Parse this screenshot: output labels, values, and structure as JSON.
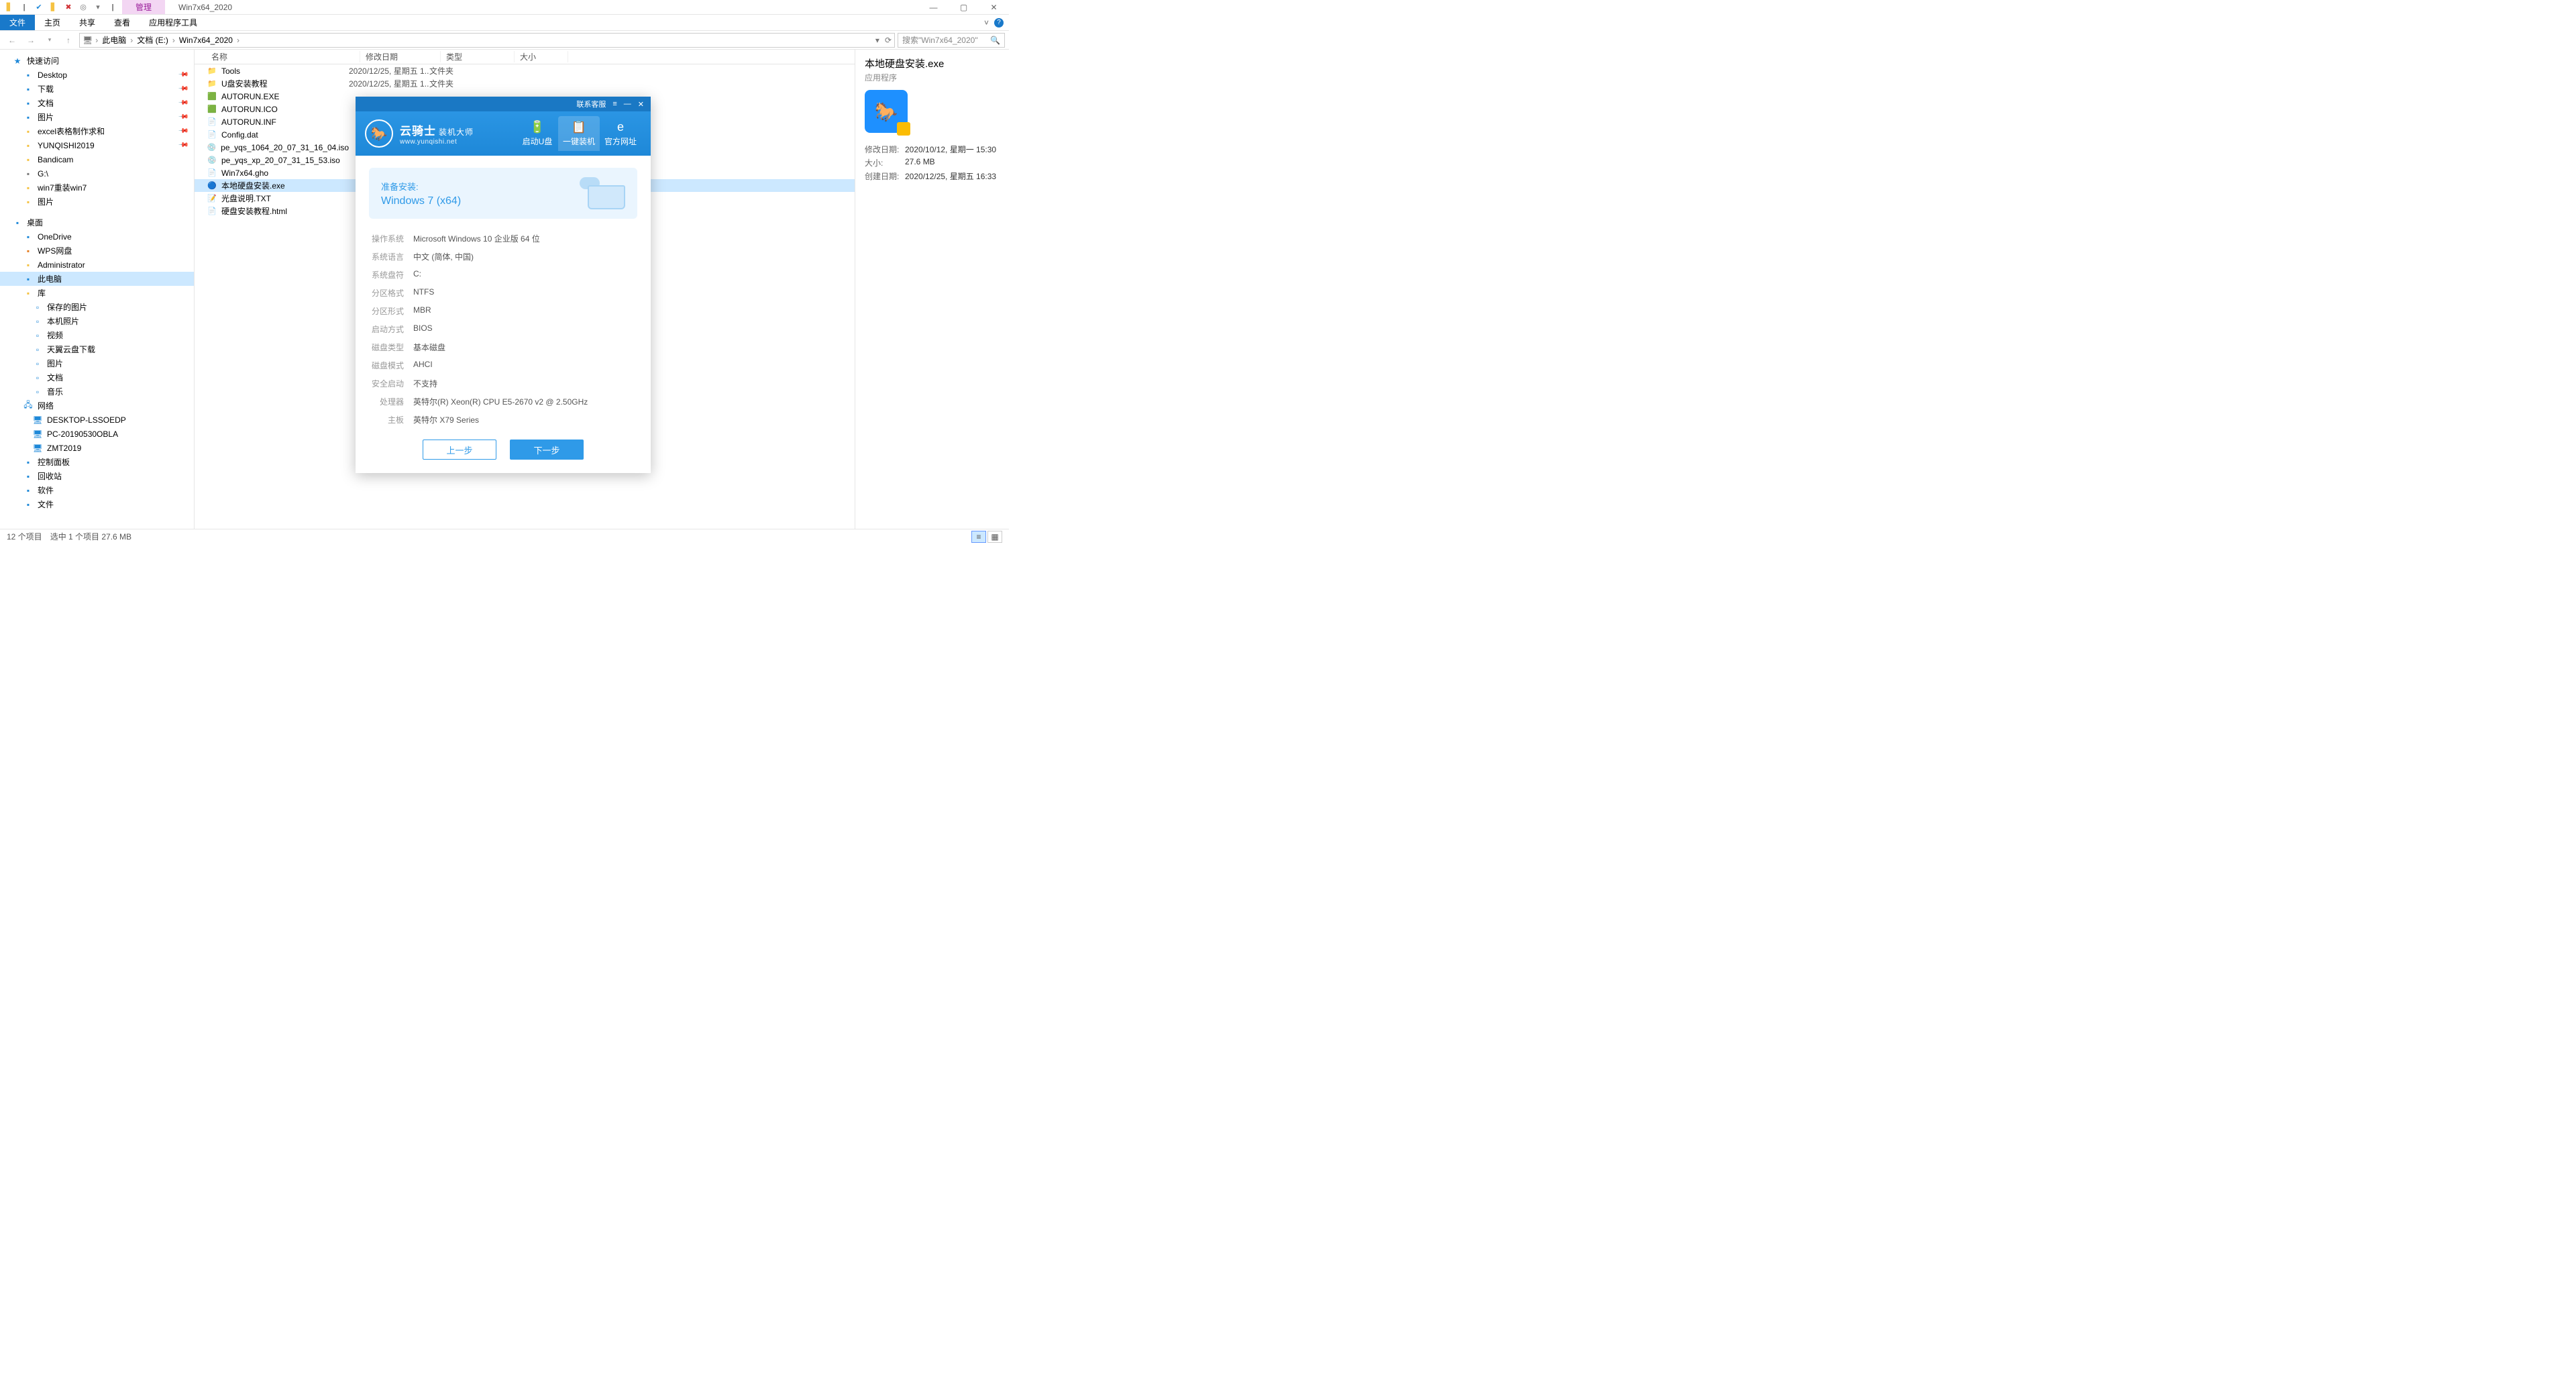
{
  "window": {
    "title": "Win7x64_2020",
    "manage_tab": "管理"
  },
  "ribbon": {
    "file": "文件",
    "tabs": [
      "主页",
      "共享",
      "查看",
      "应用程序工具"
    ]
  },
  "nav": {
    "segments": [
      "此电脑",
      "文档 (E:)",
      "Win7x64_2020"
    ],
    "search_placeholder": "搜索\"Win7x64_2020\""
  },
  "columns": {
    "name": "名称",
    "date": "修改日期",
    "type": "类型",
    "size": "大小"
  },
  "sidebar": {
    "quick": "快速访问",
    "quick_items": [
      {
        "label": "Desktop",
        "pin": true,
        "color": "ic-blue"
      },
      {
        "label": "下载",
        "pin": true,
        "color": "ic-blue"
      },
      {
        "label": "文档",
        "pin": true,
        "color": "ic-blue"
      },
      {
        "label": "图片",
        "pin": true,
        "color": "ic-blue"
      },
      {
        "label": "excel表格制作求和",
        "pin": true,
        "color": "ic-yellow"
      },
      {
        "label": "YUNQISHI2019",
        "pin": true,
        "color": "ic-yellow"
      },
      {
        "label": "Bandicam",
        "pin": false,
        "color": "ic-yellow"
      },
      {
        "label": "G:\\",
        "pin": false,
        "color": "ic-gray"
      },
      {
        "label": "win7重装win7",
        "pin": false,
        "color": "ic-yellow"
      },
      {
        "label": "图片",
        "pin": false,
        "color": "ic-yellow"
      }
    ],
    "desktop": "桌面",
    "desktop_items": [
      {
        "label": "OneDrive",
        "color": "ic-blue"
      },
      {
        "label": "WPS网盘",
        "color": "ic-orange"
      },
      {
        "label": "Administrator",
        "color": "ic-yellow"
      },
      {
        "label": "此电脑",
        "selected": true,
        "color": "ic-blue"
      },
      {
        "label": "库",
        "color": "ic-yellow"
      }
    ],
    "library_items": [
      {
        "label": "保存的图片"
      },
      {
        "label": "本机照片"
      },
      {
        "label": "视频"
      },
      {
        "label": "天翼云盘下载"
      },
      {
        "label": "图片"
      },
      {
        "label": "文档"
      },
      {
        "label": "音乐"
      }
    ],
    "network": "网络",
    "network_items": [
      {
        "label": "DESKTOP-LSSOEDP"
      },
      {
        "label": "PC-20190530OBLA"
      },
      {
        "label": "ZMT2019"
      }
    ],
    "others": [
      {
        "label": "控制面板"
      },
      {
        "label": "回收站"
      },
      {
        "label": "软件"
      },
      {
        "label": "文件"
      }
    ]
  },
  "files": [
    {
      "name": "Tools",
      "date": "2020/12/25, 星期五 1...",
      "type": "文件夹",
      "icon": "📁"
    },
    {
      "name": "U盘安装教程",
      "date": "2020/12/25, 星期五 1...",
      "type": "文件夹",
      "icon": "📁"
    },
    {
      "name": "AUTORUN.EXE",
      "date": "",
      "type": "",
      "icon": "🟩"
    },
    {
      "name": "AUTORUN.ICO",
      "date": "",
      "type": "",
      "icon": "🟩"
    },
    {
      "name": "AUTORUN.INF",
      "date": "",
      "type": "",
      "icon": "📄"
    },
    {
      "name": "Config.dat",
      "date": "",
      "type": "",
      "icon": "📄"
    },
    {
      "name": "pe_yqs_1064_20_07_31_16_04.iso",
      "date": "",
      "type": "",
      "icon": "💿"
    },
    {
      "name": "pe_yqs_xp_20_07_31_15_53.iso",
      "date": "",
      "type": "",
      "icon": "💿"
    },
    {
      "name": "Win7x64.gho",
      "date": "",
      "type": "",
      "icon": "📄"
    },
    {
      "name": "本地硬盘安装.exe",
      "date": "",
      "type": "",
      "icon": "🔵",
      "selected": true
    },
    {
      "name": "光盘说明.TXT",
      "date": "",
      "type": "",
      "icon": "📝"
    },
    {
      "name": "硬盘安装教程.html",
      "date": "",
      "type": "",
      "icon": "📄"
    }
  ],
  "details": {
    "title": "本地硬盘安装.exe",
    "subtitle": "应用程序",
    "props": [
      {
        "k": "修改日期:",
        "v": "2020/10/12, 星期一 15:30"
      },
      {
        "k": "大小:",
        "v": "27.6 MB"
      },
      {
        "k": "创建日期:",
        "v": "2020/12/25, 星期五 16:33"
      }
    ]
  },
  "status": {
    "count": "12 个项目",
    "selection": "选中 1 个项目  27.6 MB"
  },
  "dialog": {
    "topbar": {
      "contact": "联系客服"
    },
    "brand_zh": "云骑士",
    "brand_suffix": "装机大师",
    "brand_en": "www.yunqishi.net",
    "tabs": [
      {
        "label": "启动U盘",
        "icon": "🔋"
      },
      {
        "label": "一键装机",
        "icon": "📋",
        "active": true
      },
      {
        "label": "官方网址",
        "icon": "e"
      }
    ],
    "ready_title": "准备安装:",
    "ready_os": "Windows 7 (x64)",
    "info": [
      {
        "k": "操作系统",
        "v": "Microsoft Windows 10 企业版 64 位"
      },
      {
        "k": "系统语言",
        "v": "中文 (简体, 中国)"
      },
      {
        "k": "系统盘符",
        "v": "C:"
      },
      {
        "k": "分区格式",
        "v": "NTFS"
      },
      {
        "k": "分区形式",
        "v": "MBR"
      },
      {
        "k": "启动方式",
        "v": "BIOS"
      },
      {
        "k": "磁盘类型",
        "v": "基本磁盘"
      },
      {
        "k": "磁盘模式",
        "v": "AHCI"
      },
      {
        "k": "安全启动",
        "v": "不支持"
      },
      {
        "k": "处理器",
        "v": "英特尔(R) Xeon(R) CPU E5-2670 v2 @ 2.50GHz"
      },
      {
        "k": "主板",
        "v": "英特尔 X79 Series"
      }
    ],
    "btn_prev": "上一步",
    "btn_next": "下一步"
  }
}
